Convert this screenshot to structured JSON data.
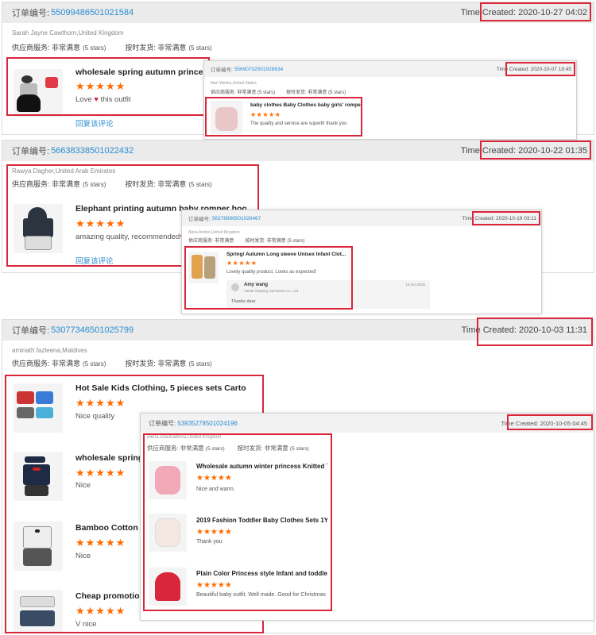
{
  "colors": {
    "accent_red": "#d9263b",
    "star_orange": "#ff6a00",
    "link_blue": "#2a8cd0"
  },
  "order_label": "订单编号:",
  "supplier_label": "供应商服务:",
  "ontime_label": "按时发货:",
  "very_satisfied": "非常满意",
  "five_stars": "(5 stars)",
  "time_prefix": "Time Created:",
  "reply_label": "回复该评论",
  "stars_glyph": "★★★★★",
  "card1": {
    "order_no": "55099486501021584",
    "time": "Time Created: 2020-10-27 04:02",
    "buyer": "Sarah Jayne Cawthorn,United Kingdom",
    "item": {
      "title": "wholesale spring autumn princess org",
      "review": "Love",
      "review_tail": "this outfit"
    }
  },
  "overlay1": {
    "order_no": "55690702501928634",
    "time": "Time Created: 2020-10-07 18:45",
    "buyer": "Mari Weeks,United States",
    "item": {
      "title": "baby clothes Baby Clothes baby girls' romper...",
      "review": "The quality and service are superb! thank you"
    }
  },
  "card2": {
    "order_no": "56638338501022432",
    "time": "Time Created: 2020-10-22 01:35",
    "buyer": "Rawya Dagher,United Arab Emirates",
    "item": {
      "title": "Elephant printing autumn baby romper hoodie ...",
      "review": "amazing quality, recommended"
    }
  },
  "overlay2": {
    "order_no": "56378896501026467",
    "time": "Time Created: 2020-10-19 03:11",
    "buyer": "Alicia Andrei,United Kingdom",
    "item": {
      "title": "Spring/ Autumn Long sleeve Unisex Infant Clot...",
      "review": "Lovely quality product. Looks as expected!"
    },
    "seller_reply": {
      "name": "Amy wang",
      "company": "Yantai Xinyang Garments Co., Ltd",
      "date": "19 Oct 2020",
      "text": "Thanks dear"
    }
  },
  "card3": {
    "order_no": "53077346501025799",
    "time": "Time Created: 2020-10-03 11:31",
    "buyer": "aminath fazleena,Maldives",
    "items": [
      {
        "title": "Hot Sale Kids Clothing, 5 pieces sets Cartoon ...",
        "review": "Nice quality"
      },
      {
        "title": "wholesale spring a",
        "review": "Nice"
      },
      {
        "title": "Bamboo Cotton Hot S",
        "review": "Nice"
      },
      {
        "title": "Cheap promotion s",
        "review": "V nice"
      }
    ]
  },
  "overlay3": {
    "order_no": "53935278501024196",
    "time": "Time Created: 2020-10-05 04:45",
    "buyer": "elena shashabrina,United Kingdom",
    "items": [
      {
        "title": "Wholesale autumn winter princess Knitted Thic...",
        "review": "Nice and warm."
      },
      {
        "title": "2019 Fashion Toddler Baby Clothes Sets 1Year ...",
        "review": "Thank you"
      },
      {
        "title": "Plain Color Princess style Infant and toddler Cl...",
        "review": "Beautiful baby outfit. Well made. Good for Christmas"
      }
    ]
  }
}
